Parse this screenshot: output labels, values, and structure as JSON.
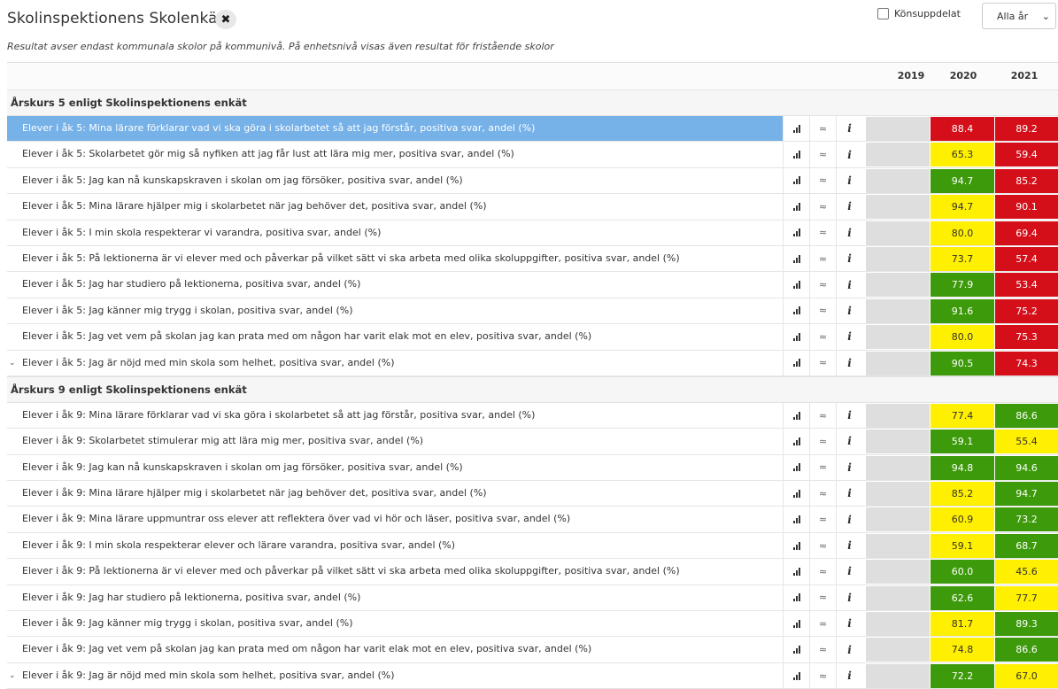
{
  "header": {
    "title": "Skolinspektionens Skolenkät",
    "subtitle": "Resultat avser endast kommunala skolor på kommunivå. På enhetsnivå visas även resultat för fristående skolor",
    "gender_label": "Könsuppdelat",
    "year_select": "Alla år"
  },
  "columns": {
    "y2019": "2019",
    "y2020": "2020",
    "y2021": "2021"
  },
  "colors": {
    "red": "#d40f1a",
    "green": "#3d9a0b",
    "yellow": "#ffef00",
    "selected": "#76b1e8"
  },
  "sections": [
    {
      "title": "Årskurs 5 enligt Skolinspektionens enkät",
      "rows": [
        {
          "label": "Elever i åk 5: Mina lärare förklarar vad vi ska göra i skolarbetet så att jag förstår, positiva svar, andel (%)",
          "v2020": "88.4",
          "c2020": "red",
          "v2021": "89.2",
          "c2021": "red",
          "selected": true
        },
        {
          "label": "Elever i åk 5: Skolarbetet gör mig så nyfiken att jag får lust att lära mig mer, positiva svar, andel (%)",
          "v2020": "65.3",
          "c2020": "yellow",
          "v2021": "59.4",
          "c2021": "red"
        },
        {
          "label": "Elever i åk 5: Jag kan nå kunskapskraven i skolan om jag försöker, positiva svar, andel (%)",
          "v2020": "94.7",
          "c2020": "green",
          "v2021": "85.2",
          "c2021": "red"
        },
        {
          "label": "Elever i åk 5: Mina lärare hjälper mig i skolarbetet när jag behöver det, positiva svar, andel (%)",
          "v2020": "94.7",
          "c2020": "yellow",
          "v2021": "90.1",
          "c2021": "red"
        },
        {
          "label": "Elever i åk 5: I min skola respekterar vi varandra, positiva svar, andel (%)",
          "v2020": "80.0",
          "c2020": "yellow",
          "v2021": "69.4",
          "c2021": "red"
        },
        {
          "label": "Elever i åk 5: På lektionerna är vi elever med och påverkar på vilket sätt vi ska arbeta med olika skoluppgifter, positiva svar, andel (%)",
          "v2020": "73.7",
          "c2020": "yellow",
          "v2021": "57.4",
          "c2021": "red"
        },
        {
          "label": "Elever i åk 5: Jag har studiero på lektionerna, positiva svar, andel (%)",
          "v2020": "77.9",
          "c2020": "green",
          "v2021": "53.4",
          "c2021": "red"
        },
        {
          "label": "Elever i åk 5: Jag känner mig trygg i skolan, positiva svar, andel (%)",
          "v2020": "91.6",
          "c2020": "green",
          "v2021": "75.2",
          "c2021": "red"
        },
        {
          "label": "Elever i åk 5: Jag vet vem på skolan jag kan prata med om någon har varit elak mot en elev, positiva svar, andel (%)",
          "v2020": "80.0",
          "c2020": "yellow",
          "v2021": "75.3",
          "c2021": "red"
        },
        {
          "label": "Elever i åk 5: Jag är nöjd med min skola som helhet, positiva svar, andel (%)",
          "v2020": "90.5",
          "c2020": "green",
          "v2021": "74.3",
          "c2021": "red",
          "caret": true
        }
      ]
    },
    {
      "title": "Årskurs 9 enligt Skolinspektionens enkät",
      "rows": [
        {
          "label": "Elever i åk 9: Mina lärare förklarar vad vi ska göra i skolarbetet så att jag förstår, positiva svar, andel (%)",
          "v2020": "77.4",
          "c2020": "yellow",
          "v2021": "86.6",
          "c2021": "green"
        },
        {
          "label": "Elever i åk 9: Skolarbetet stimulerar mig att lära mig mer, positiva svar, andel (%)",
          "v2020": "59.1",
          "c2020": "green",
          "v2021": "55.4",
          "c2021": "yellow"
        },
        {
          "label": "Elever i åk 9: Jag kan nå kunskapskraven i skolan om jag försöker, positiva svar, andel (%)",
          "v2020": "94.8",
          "c2020": "green",
          "v2021": "94.6",
          "c2021": "green"
        },
        {
          "label": "Elever i åk 9: Mina lärare hjälper mig i skolarbetet när jag behöver det, positiva svar, andel (%)",
          "v2020": "85.2",
          "c2020": "yellow",
          "v2021": "94.7",
          "c2021": "green"
        },
        {
          "label": "Elever i åk 9: Mina lärare uppmuntrar oss elever att reflektera över vad vi hör och läser, positiva svar, andel (%)",
          "v2020": "60.9",
          "c2020": "yellow",
          "v2021": "73.2",
          "c2021": "green"
        },
        {
          "label": "Elever i åk 9: I min skola respekterar elever och lärare varandra, positiva svar, andel (%)",
          "v2020": "59.1",
          "c2020": "yellow",
          "v2021": "68.7",
          "c2021": "green"
        },
        {
          "label": "Elever i åk 9: På lektionerna är vi elever med och påverkar på vilket sätt vi ska arbeta med olika skoluppgifter, positiva svar, andel (%)",
          "v2020": "60.0",
          "c2020": "green",
          "v2021": "45.6",
          "c2021": "yellow"
        },
        {
          "label": "Elever i åk 9: Jag har studiero på lektionerna, positiva svar, andel (%)",
          "v2020": "62.6",
          "c2020": "green",
          "v2021": "77.7",
          "c2021": "yellow"
        },
        {
          "label": "Elever i åk 9: Jag känner mig trygg i skolan, positiva svar, andel (%)",
          "v2020": "81.7",
          "c2020": "yellow",
          "v2021": "89.3",
          "c2021": "green"
        },
        {
          "label": "Elever i åk 9: Jag vet vem på skolan jag kan prata med om någon har varit elak mot en elev, positiva svar, andel (%)",
          "v2020": "74.8",
          "c2020": "yellow",
          "v2021": "86.6",
          "c2021": "green"
        },
        {
          "label": "Elever i åk 9: Jag är nöjd med min skola som helhet, positiva svar, andel (%)",
          "v2020": "72.2",
          "c2020": "green",
          "v2021": "67.0",
          "c2021": "yellow",
          "caret": true
        }
      ]
    }
  ]
}
